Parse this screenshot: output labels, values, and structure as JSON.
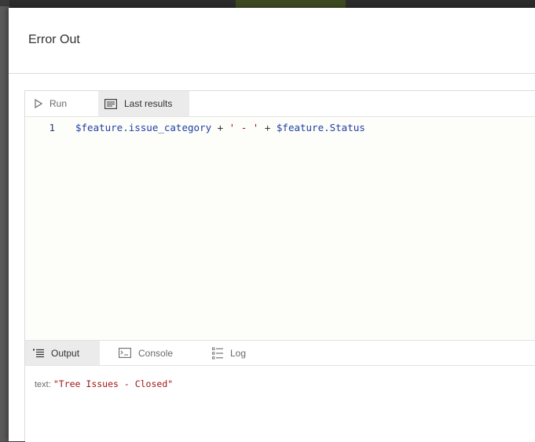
{
  "dialog": {
    "title": "Error Out"
  },
  "editor": {
    "tabs": [
      {
        "label": "Run",
        "icon": "play-icon"
      },
      {
        "label": "Last results",
        "icon": "results-icon"
      }
    ],
    "active_tab": "Last results",
    "code": {
      "line_number": "1",
      "tokens": {
        "t1": "$feature.issue_category",
        "t2": " + ",
        "t3": "' - '",
        "t4": " + ",
        "t5": "$feature.Status"
      }
    }
  },
  "output_panel": {
    "tabs": [
      {
        "label": "Output",
        "icon": "list-icon"
      },
      {
        "label": "Console",
        "icon": "console-icon"
      },
      {
        "label": "Log",
        "icon": "log-icon"
      }
    ],
    "active_tab": "Output",
    "result": {
      "label": "text:",
      "value": "\"Tree Issues - Closed\""
    }
  },
  "colors": {
    "code_variable": "#1f3fa6",
    "code_string": "#a31515",
    "active_tab_bg": "#ebebeb"
  }
}
